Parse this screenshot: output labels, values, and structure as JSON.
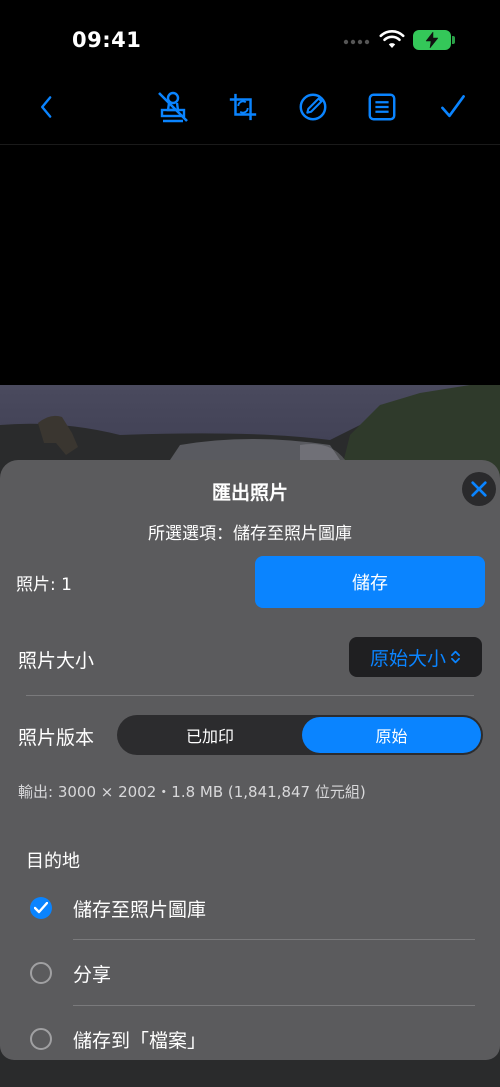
{
  "status_bar": {
    "time": "09:41"
  },
  "toolbar": {
    "icons": [
      "back-icon",
      "stamp-icon",
      "crop-icon",
      "markup-icon",
      "list-icon",
      "done-icon"
    ],
    "accent_color": "#0a84ff"
  },
  "export_sheet": {
    "title": "匯出照片",
    "subtitle": "所選選項：儲存至照片圖庫",
    "photo_count_label": "照片: 1",
    "save_button": "儲存",
    "size": {
      "label": "照片大小",
      "value": "原始大小"
    },
    "version": {
      "label": "照片版本",
      "options": [
        "已加印",
        "原始"
      ],
      "selected": "原始"
    },
    "output_info": "輸出: 3000 × 2002・1.8 MB (1,841,847 位元組)",
    "destination": {
      "title": "目的地",
      "options": [
        {
          "label": "儲存至照片圖庫",
          "checked": true
        },
        {
          "label": "分享",
          "checked": false
        },
        {
          "label": "儲存到「檔案」",
          "checked": false
        }
      ]
    }
  }
}
